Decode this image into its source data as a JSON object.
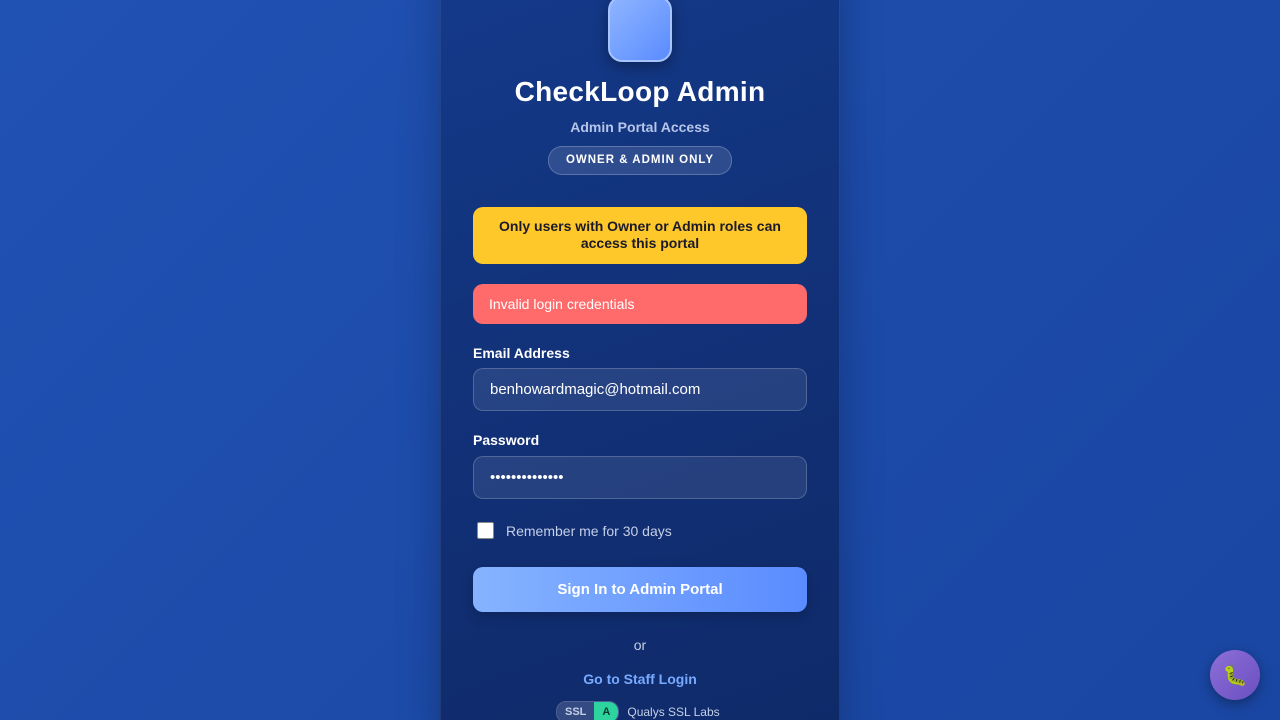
{
  "app": {
    "title": "CheckLoop Admin",
    "subtitle": "Admin Portal Access",
    "badge": "OWNER & ADMIN ONLY"
  },
  "alerts": {
    "warning": "Only users with Owner or Admin roles can access this portal",
    "error": "Invalid login credentials"
  },
  "form": {
    "email_label": "Email Address",
    "email_value": "benhowardmagic@hotmail.com",
    "password_label": "Password",
    "password_value": "••••••••••••••",
    "remember_label": "Remember me for 30 days",
    "remember_checked": false,
    "submit_label": "Sign In to Admin Portal"
  },
  "footer": {
    "or_text": "or",
    "staff_link": "Go to Staff Login",
    "ssl_label": "SSL",
    "ssl_grade": "A",
    "ssl_provider": "Qualys SSL Labs"
  },
  "fab": {
    "icon": "bug-icon",
    "glyph": "🐛"
  },
  "colors": {
    "background": "#1f4fb0",
    "card": "#112f74",
    "warning": "#fec72a",
    "error": "#ff6a6a",
    "primary_button": "#5a8cff",
    "link": "#78aaff",
    "ssl_grade": "#2dd4a0"
  }
}
